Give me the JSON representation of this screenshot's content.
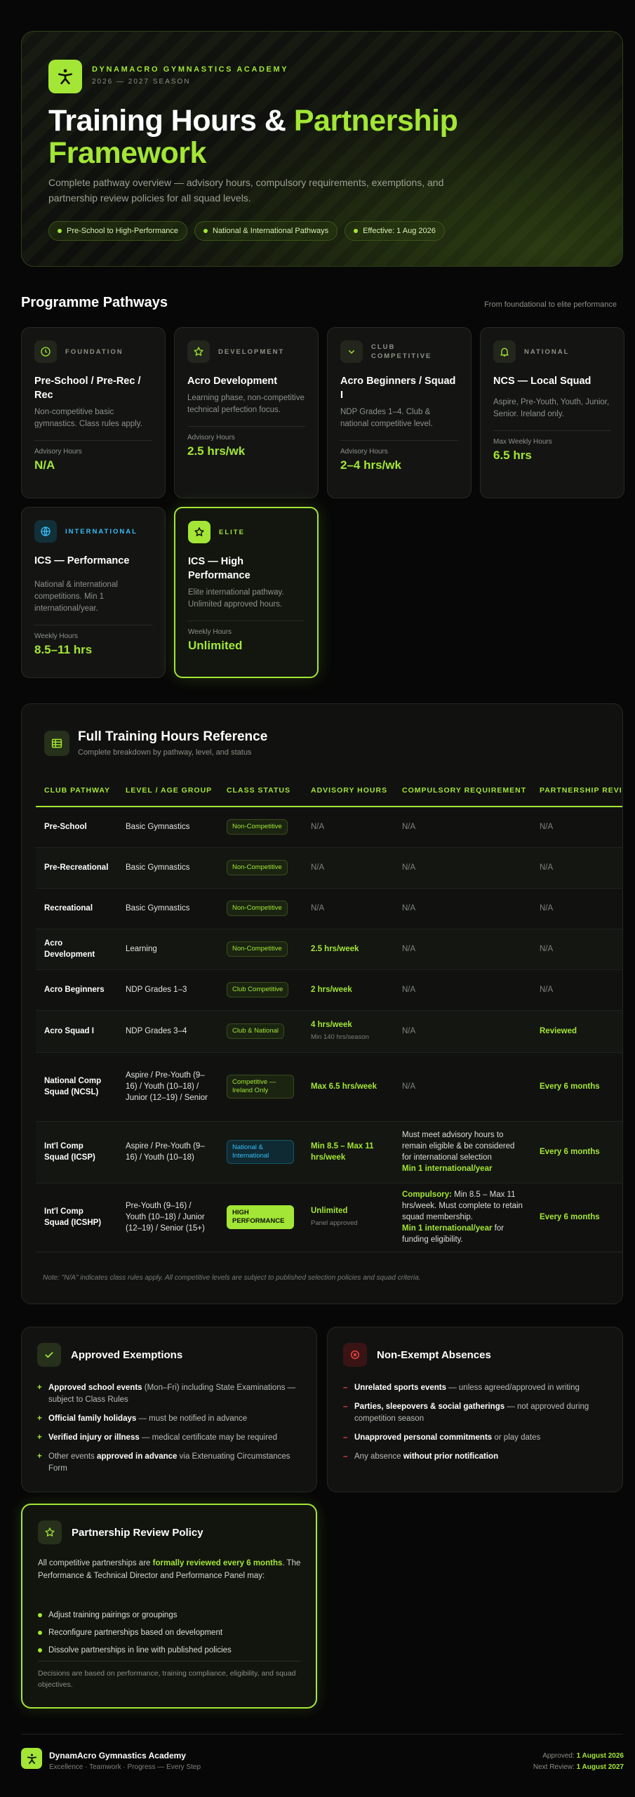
{
  "hero": {
    "brand_name": "DYNAMACRO GYMNASTICS ACADEMY",
    "season": "2026 — 2027 SEASON",
    "title_part1": "Training Hours & ",
    "title_part2": "Partnership Framework",
    "description": "Complete pathway overview — advisory hours, compulsory requirements, exemptions, and partnership review policies for all squad levels.",
    "pills": [
      "Pre-School to High-Performance",
      "National & International Pathways",
      "Effective: 1 Aug 2026"
    ]
  },
  "pathways": {
    "title": "Programme Pathways",
    "note": "From foundational to elite performance",
    "cards": [
      {
        "tag": "FOUNDATION",
        "name": "Pre-School / Pre-Rec / Rec",
        "desc": "Non-competitive basic gymnastics. Class rules apply.",
        "label": "Advisory Hours",
        "value": "N/A",
        "icon": "clock-icon"
      },
      {
        "tag": "DEVELOPMENT",
        "name": "Acro Development",
        "desc": "Learning phase, non-competitive technical perfection focus.",
        "label": "Advisory Hours",
        "value": "2.5 hrs/wk",
        "icon": "star-outline-icon"
      },
      {
        "tag": "CLUB COMPETITIVE",
        "name": "Acro Beginners / Squad I",
        "desc": "NDP Grades 1–4. Club & national competitive level.",
        "label": "Advisory Hours",
        "value": "2–4 hrs/wk",
        "icon": "chevron-down-icon"
      },
      {
        "tag": "NATIONAL",
        "name": "NCS — Local Squad",
        "desc": "Aspire, Pre-Youth, Youth, Junior, Senior. Ireland only.",
        "label": "Max Weekly Hours",
        "value": "6.5 hrs",
        "icon": "bell-icon"
      },
      {
        "tag": "INTERNATIONAL",
        "name": "ICS — Performance",
        "desc": "National & international competitions. Min 1 international/year.",
        "label": "Weekly Hours",
        "value": "8.5–11 hrs",
        "icon": "globe-icon"
      },
      {
        "tag": "ELITE",
        "name": "ICS — High Performance",
        "desc": "Elite international pathway. Unlimited approved hours.",
        "label": "Weekly Hours",
        "value": "Unlimited",
        "icon": "star-icon"
      }
    ]
  },
  "table": {
    "title": "Full Training Hours Reference",
    "subtitle": "Complete breakdown by pathway, level, and status",
    "headers": [
      "CLUB PATHWAY",
      "LEVEL / AGE GROUP",
      "CLASS STATUS",
      "ADVISORY HOURS",
      "COMPULSORY REQUIREMENT",
      "PARTNERSHIP REVIEW"
    ],
    "rows": [
      {
        "club": "Pre-School",
        "level": "Basic Gymnastics",
        "status": "Non-Competitive",
        "hours": "N/A",
        "hours_note": "",
        "req": "N/A",
        "req_hl": "",
        "req_tail": "",
        "req_hl2": "",
        "req_tail2": "",
        "partner": "N/A"
      },
      {
        "club": "Pre-Recreational",
        "level": "Basic Gymnastics",
        "status": "Non-Competitive",
        "hours": "N/A",
        "hours_note": "",
        "req": "N/A",
        "req_hl": "",
        "req_tail": "",
        "req_hl2": "",
        "req_tail2": "",
        "partner": "N/A"
      },
      {
        "club": "Recreational",
        "level": "Basic Gymnastics",
        "status": "Non-Competitive",
        "hours": "N/A",
        "hours_note": "",
        "req": "N/A",
        "req_hl": "",
        "req_tail": "",
        "req_hl2": "",
        "req_tail2": "",
        "partner": "N/A"
      },
      {
        "club": "Acro Development",
        "level": "Learning",
        "status": "Non-Competitive",
        "hours": "2.5 hrs/week",
        "hours_note": "",
        "req": "N/A",
        "req_hl": "",
        "req_tail": "",
        "req_hl2": "",
        "req_tail2": "",
        "partner": "N/A"
      },
      {
        "club": "Acro Beginners",
        "level": "NDP Grades 1–3",
        "status": "Club Competitive",
        "hours": "2 hrs/week",
        "hours_note": "",
        "req": "N/A",
        "req_hl": "",
        "req_tail": "",
        "req_hl2": "",
        "req_tail2": "",
        "partner": "N/A"
      },
      {
        "club": "Acro Squad I",
        "level": "NDP Grades 3–4",
        "status": "Club & National",
        "hours": "4 hrs/week",
        "hours_note": "Min 140 hrs/season",
        "req": "N/A",
        "req_hl": "",
        "req_tail": "",
        "req_hl2": "",
        "req_tail2": "",
        "partner": "Reviewed"
      },
      {
        "club": "National Comp Squad (NCSL)",
        "level": "Aspire / Pre-Youth (9–16) / Youth (10–18) / Junior (12–19) / Senior",
        "status": "Competitive — Ireland Only",
        "hours": "Max 6.5 hrs/week",
        "hours_note": "",
        "req": "N/A",
        "req_hl": "",
        "req_tail": "",
        "req_hl2": "",
        "req_tail2": "",
        "partner": "Every 6 months"
      },
      {
        "club": "Int'l Comp Squad (ICSP)",
        "level": "Aspire / Pre-Youth (9–16) / Youth (10–18)",
        "status": "National & International",
        "hours": "Min 8.5 – Max 11 hrs/week",
        "hours_note": "",
        "req": "Must meet advisory hours to remain eligible & be considered for international selection",
        "req_hl": "",
        "req_tail": "",
        "req_hl2": "Min 1 international/year",
        "req_tail2": "",
        "partner": "Every 6 months"
      },
      {
        "club": "Int'l Comp Squad (ICSHP)",
        "level": "Pre-Youth (9–16) / Youth (10–18) / Junior (12–19) / Senior (15+)",
        "status": "HIGH PERFORMANCE",
        "hours": "Unlimited",
        "hours_note": "Panel approved",
        "req": "",
        "req_hl": "Compulsory:",
        "req_tail": " Min 8.5 – Max 11 hrs/week. Must complete to retain squad membership.",
        "req_hl2": "Min 1 international/year",
        "req_tail2": " for funding eligibility.",
        "partner": "Every 6 months"
      }
    ],
    "note": "Note: \"N/A\" indicates class rules apply. All competitive levels are subject to published selection policies and squad criteria."
  },
  "exemptions": {
    "title": "Approved Exemptions",
    "items": [
      {
        "bold": "Approved school events",
        "text": " (Mon–Fri) including State Examinations — subject to Class Rules"
      },
      {
        "bold": "Official family holidays",
        "text": " — must be notified in advance"
      },
      {
        "bold": "Verified injury or illness",
        "text": " — medical certificate may be required"
      },
      {
        "bold": "approved in advance",
        "pre": "Other events ",
        "text": " via Extenuating Circumstances Form"
      }
    ]
  },
  "absences": {
    "title": "Non-Exempt Absences",
    "items": [
      {
        "bold": "Unrelated sports events",
        "text": " — unless agreed/approved in writing"
      },
      {
        "bold": "Parties, sleepovers & social gatherings",
        "text": " — not approved during competition season"
      },
      {
        "bold": "Unapproved personal commitments",
        "text": " or play dates"
      },
      {
        "bold": "without prior notification",
        "pre": "Any absence ",
        "text": ""
      }
    ]
  },
  "policy": {
    "title": "Partnership Review Policy",
    "text_pre": "All competitive partnerships are ",
    "text_hl": "formally reviewed every 6 months",
    "text_post": ". The Performance & Technical Director and Performance Panel may:",
    "items": [
      "Adjust training pairings or groupings",
      "Reconfigure partnerships based on development",
      "Dissolve partnerships in line with published policies"
    ],
    "footnote": "Decisions are based on performance, training compliance, eligibility, and squad objectives."
  },
  "footer": {
    "name": "DynamAcro Gymnastics Academy",
    "tagline": "Excellence · Teamwork · Progress — Every Step",
    "approved_label": "Approved: ",
    "approved_date": "1 August 2026",
    "review_label": "Next Review: ",
    "review_date": "1 August 2027"
  },
  "colors": {
    "accent": "#a3e635",
    "info": "#38bdf8",
    "danger": "#ef4444",
    "background": "#070707"
  }
}
